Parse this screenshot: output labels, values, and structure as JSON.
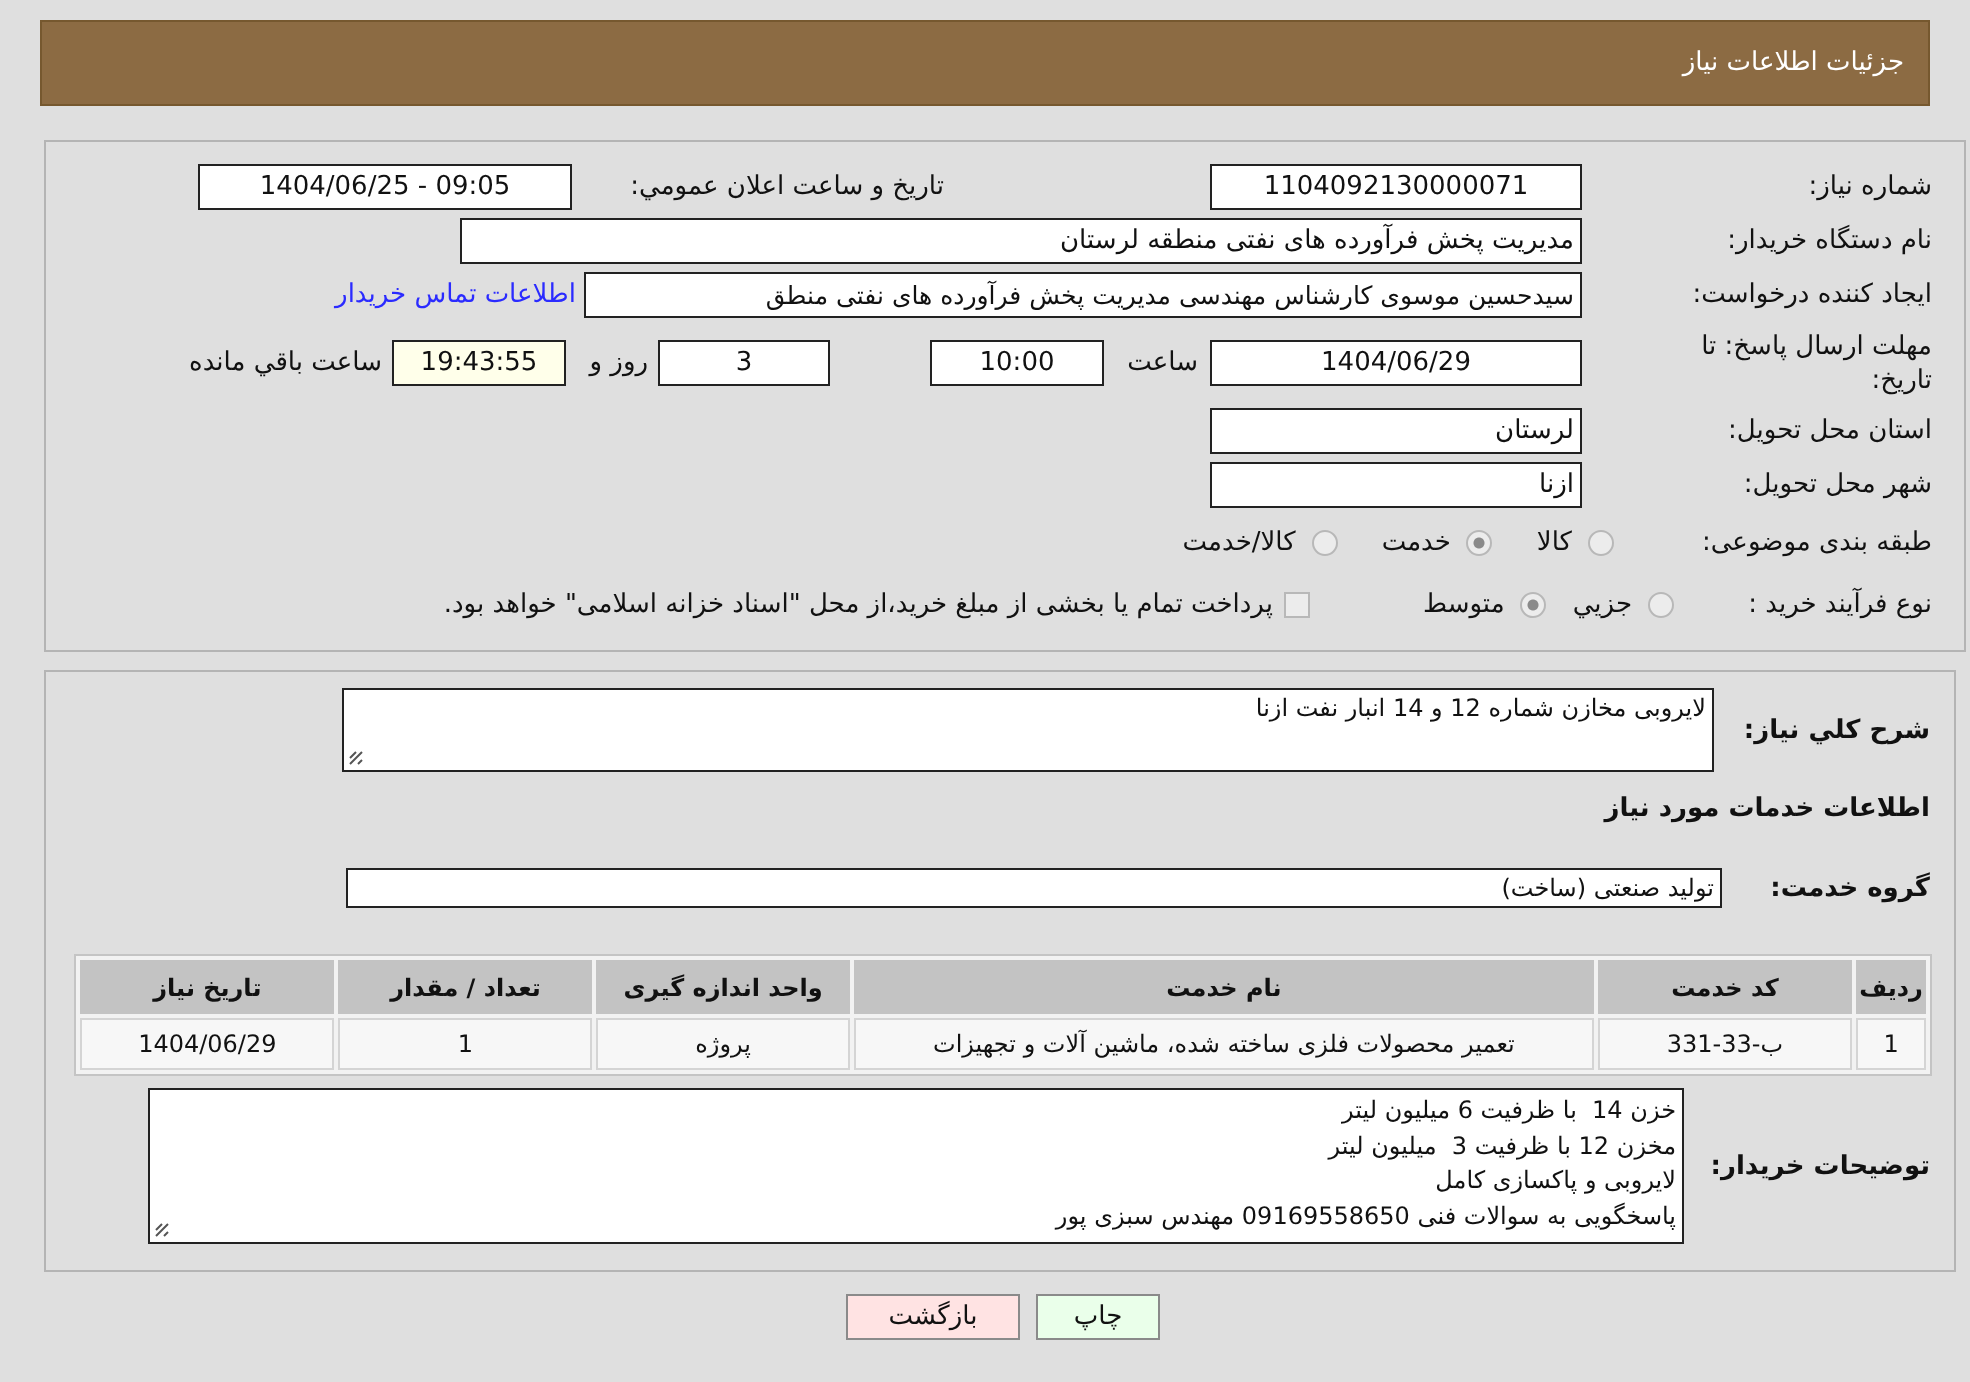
{
  "header": {
    "title": "جزئیات اطلاعات نیاز"
  },
  "details": {
    "need_number": {
      "label": "شماره نیاز:",
      "value": "1104092130000071"
    },
    "announcement": {
      "label": "تاريخ و ساعت اعلان عمومي:",
      "value": "1404/06/25 - 09:05"
    },
    "buyer_org": {
      "label": "نام دستگاه خریدار:",
      "value": "مدیریت پخش فرآورده های نفتی منطقه لرستان"
    },
    "creator": {
      "label": "ایجاد کننده درخواست:",
      "value": "سیدحسین موسوی کارشناس مهندسی مدیریت پخش فرآورده های نفتی منطق",
      "contact_link": "اطلاعات تماس خریدار"
    },
    "deadline": {
      "label": "مهلت ارسال پاسخ: تا تاریخ:",
      "date": "1404/06/29",
      "time_label": "ساعت",
      "time": "10:00",
      "days": "3",
      "days_label": "روز و",
      "remaining": "19:43:55",
      "remaining_label": "ساعت باقي مانده"
    },
    "province": {
      "label": "استان محل تحویل:",
      "value": "لرستان"
    },
    "city": {
      "label": "شهر محل تحویل:",
      "value": "ازنا"
    },
    "category": {
      "label": "طبقه بندی موضوعی:",
      "options": [
        {
          "label": "کالا",
          "selected": false
        },
        {
          "label": "خدمت",
          "selected": true
        },
        {
          "label": "کالا/خدمت",
          "selected": false
        }
      ]
    },
    "purchase_process": {
      "label": "نوع فرآیند خرید :",
      "options": [
        {
          "label": "جزيي",
          "selected": false
        },
        {
          "label": "متوسط",
          "selected": true
        }
      ],
      "treasury": {
        "label": "پرداخت تمام یا بخشی از مبلغ خرید،از محل \"اسناد خزانه اسلامی\" خواهد بود.",
        "checked": false
      }
    }
  },
  "description": {
    "label": "شرح کلي نیاز:",
    "value": "لایروبی مخازن شماره 12 و 14 انبار نفت ازنا"
  },
  "services_heading": "اطلاعات خدمات مورد نیاز",
  "service_group": {
    "label": "گروه خدمت:",
    "value": "تولید صنعتی (ساخت)"
  },
  "table": {
    "columns": [
      "ردیف",
      "کد خدمت",
      "نام خدمت",
      "واحد اندازه گیری",
      "تعداد / مقدار",
      "تاریخ نیاز"
    ],
    "rows": [
      [
        "1",
        "ب-33-331",
        "تعمیر محصولات فلزی ساخته شده، ماشین آلات و تجهیزات",
        "پروژه",
        "1",
        "1404/06/29"
      ]
    ]
  },
  "buyer_notes": {
    "label": "توضیحات خریدار:",
    "lines": [
      "خزن 14  با ظرفیت 6 میلیون لیتر",
      "مخزن 12 با ظرفیت 3  میلیون لیتر",
      "لایروبی و پاکسازی کامل",
      "پاسخگویی به سوالات فنی 09169558650 مهندس سبزی پور"
    ]
  },
  "buttons": [
    {
      "label": "چاپ",
      "kind": "print"
    },
    {
      "label": "بازگشت",
      "kind": "back"
    }
  ]
}
